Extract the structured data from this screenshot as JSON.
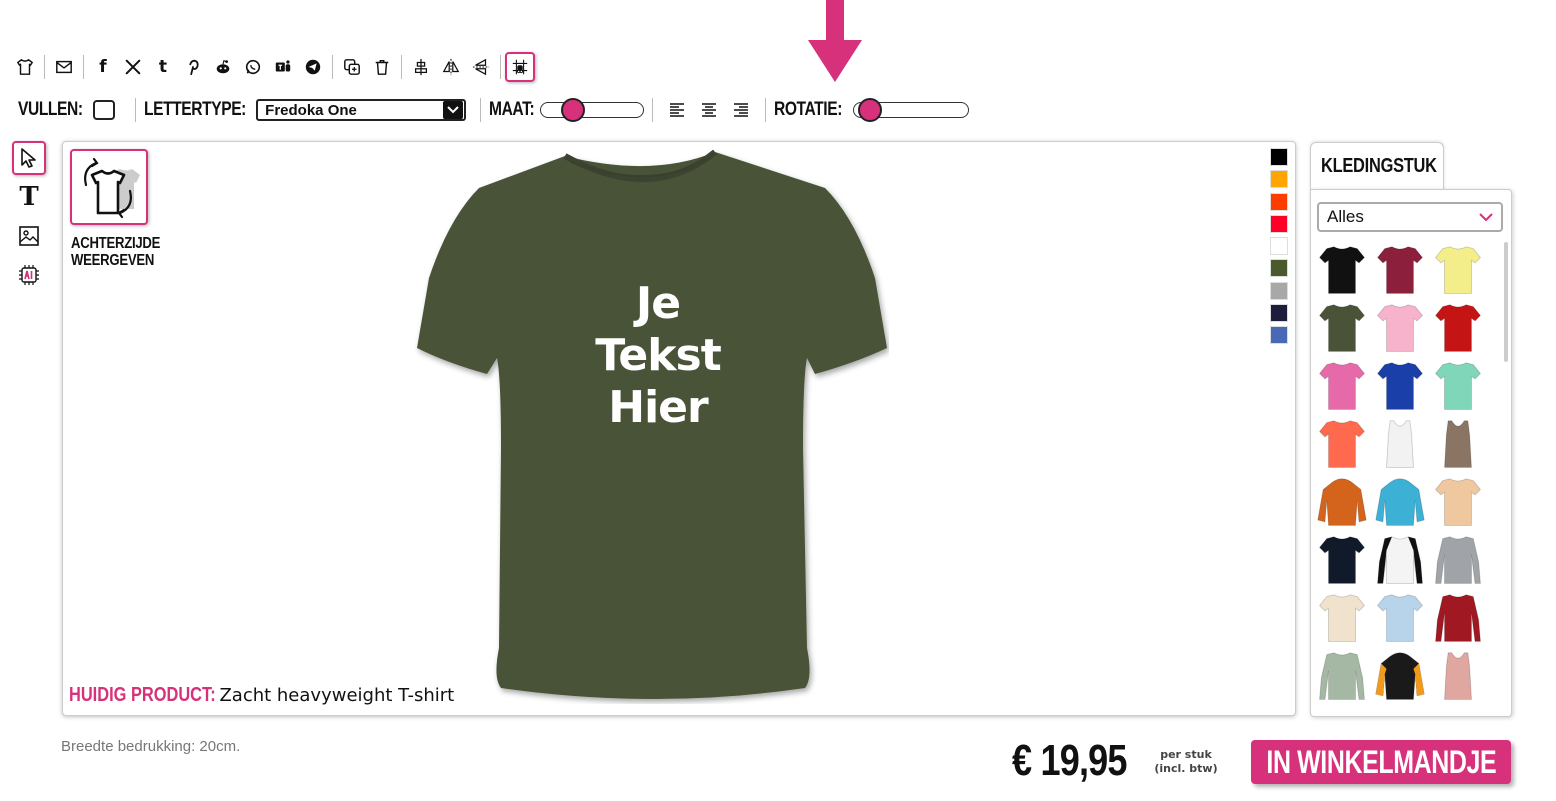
{
  "toolbar": {
    "icons": [
      "tshirt-icon",
      "mail-icon",
      "facebook-icon",
      "x-icon",
      "tumblr-icon",
      "pinterest-icon",
      "reddit-icon",
      "whatsapp-icon",
      "teams-icon",
      "telegram-icon",
      "duplicate-icon",
      "trash-icon",
      "center-align-icon",
      "flip-horizontal-icon",
      "flip-vertical-icon",
      "grid-snap-icon"
    ],
    "facebook_glyph": "f",
    "x_glyph": "𝕏",
    "tumblr_glyph": "t"
  },
  "options": {
    "fill_label": "VULLEN:",
    "font_label": "LETTERTYPE:",
    "font_value": "Fredoka One",
    "size_label": "MAAT:",
    "size_value": 0.2,
    "rotation_label": "ROTATIE:",
    "rotation_value": 0.0
  },
  "tools": {
    "text_glyph": "T",
    "items": [
      "select-tool",
      "text-tool",
      "image-tool",
      "ai-tool"
    ]
  },
  "canvas": {
    "back_view_label_1": "ACHTERZIJDE",
    "back_view_label_2": "WEERGEVEN",
    "shirt_color": "#4a5238",
    "design_text_line1": "Je",
    "design_text_line2": "Tekst",
    "design_text_line3": "Hier",
    "current_product_label": "HUIDIG PRODUCT:",
    "current_product_value": "Zacht heavyweight T-shirt",
    "swatch_colors": [
      "#000000",
      "#ffa500",
      "#ff3c00",
      "#ff0028",
      "#ffffff",
      "#4a5a2c",
      "#a8a8a8",
      "#1e1e3c",
      "#4a68b8"
    ]
  },
  "garments": {
    "tab_label": "KLEDINGSTUK",
    "filter_value": "Alles",
    "items": [
      {
        "name": "tshirt-black",
        "color": "#111111"
      },
      {
        "name": "tshirt-burgundy",
        "color": "#8b1f3c"
      },
      {
        "name": "tshirt-yellow",
        "color": "#f4ee8a"
      },
      {
        "name": "tshirt-olive",
        "color": "#4a5238"
      },
      {
        "name": "tshirt-pink",
        "color": "#f7b3cc"
      },
      {
        "name": "tshirt-red",
        "color": "#c41414"
      },
      {
        "name": "tshirt-magenta",
        "color": "#e66aaa"
      },
      {
        "name": "tshirt-royal",
        "color": "#1a3fa8"
      },
      {
        "name": "tshirt-mint",
        "color": "#7fd6b8"
      },
      {
        "name": "tshirt-coral",
        "color": "#ff6a4e"
      },
      {
        "name": "tanktop-white",
        "color": "#f2f2f2"
      },
      {
        "name": "tanktop-brown",
        "color": "#8a7464"
      },
      {
        "name": "hoodie-orange",
        "color": "#d4641c"
      },
      {
        "name": "hoodie-turquoise",
        "color": "#3db0d6"
      },
      {
        "name": "tshirt-tiedye",
        "color": "#f0c8a0"
      },
      {
        "name": "tshirt-navy",
        "color": "#111a2a"
      },
      {
        "name": "raglan-black-white",
        "color": "#f4f4f4"
      },
      {
        "name": "sweater-grey",
        "color": "#a0a4a8"
      },
      {
        "name": "tshirt-cream",
        "color": "#f0e2cc"
      },
      {
        "name": "tshirt-ombre-blue",
        "color": "#b8d4ea"
      },
      {
        "name": "varsity-red",
        "color": "#a01822"
      },
      {
        "name": "longsleeve-sage",
        "color": "#a4b8a4"
      },
      {
        "name": "hoodie-black-orange",
        "color": "#1a1a1a"
      },
      {
        "name": "tanktop-dusty-pink",
        "color": "#e0a6a0"
      }
    ]
  },
  "footer": {
    "print_width": "Breedte bedrukking: 20cm.",
    "price": "€ 19,95",
    "price_note_1": "per stuk",
    "price_note_2": "(incl. btw)",
    "cart_button": "IN WINKELMANDJE"
  },
  "colors": {
    "accent": "#d6317a"
  }
}
